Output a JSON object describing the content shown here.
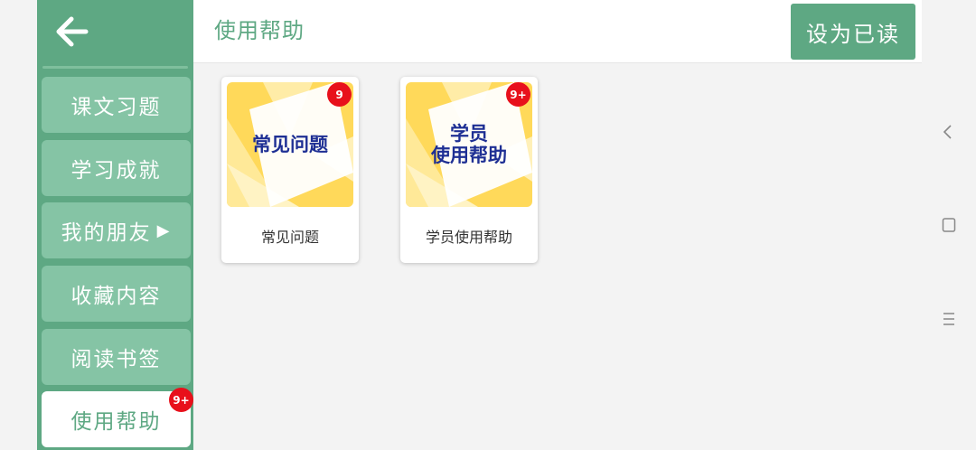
{
  "header": {
    "title": "使用帮助",
    "mark_read_label": "设为已读"
  },
  "sidebar": {
    "items": [
      {
        "label": "课文习题"
      },
      {
        "label": "学习成就"
      },
      {
        "label": "我的朋友",
        "arrow": "▶"
      },
      {
        "label": "收藏内容"
      },
      {
        "label": "阅读书签"
      },
      {
        "label": "使用帮助",
        "badge": "9+",
        "active": true
      }
    ]
  },
  "cards": [
    {
      "thumb_line1": "常见问题",
      "thumb_line2": "",
      "label": "常见问题",
      "badge": "9"
    },
    {
      "thumb_line1": "学员",
      "thumb_line2": "使用帮助",
      "label": "学员使用帮助",
      "badge": "9+"
    }
  ],
  "colors": {
    "accent": "#5ea883",
    "sidebar_item": "#85c4a5",
    "badge": "#e8101b",
    "thumb_yellow": "#ffd95a",
    "thumb_text": "#1e2f94"
  },
  "icons": {
    "back": "back-arrow-icon",
    "system_back": "chevron-left-icon",
    "system_home": "square-icon",
    "system_menu": "menu-icon"
  }
}
